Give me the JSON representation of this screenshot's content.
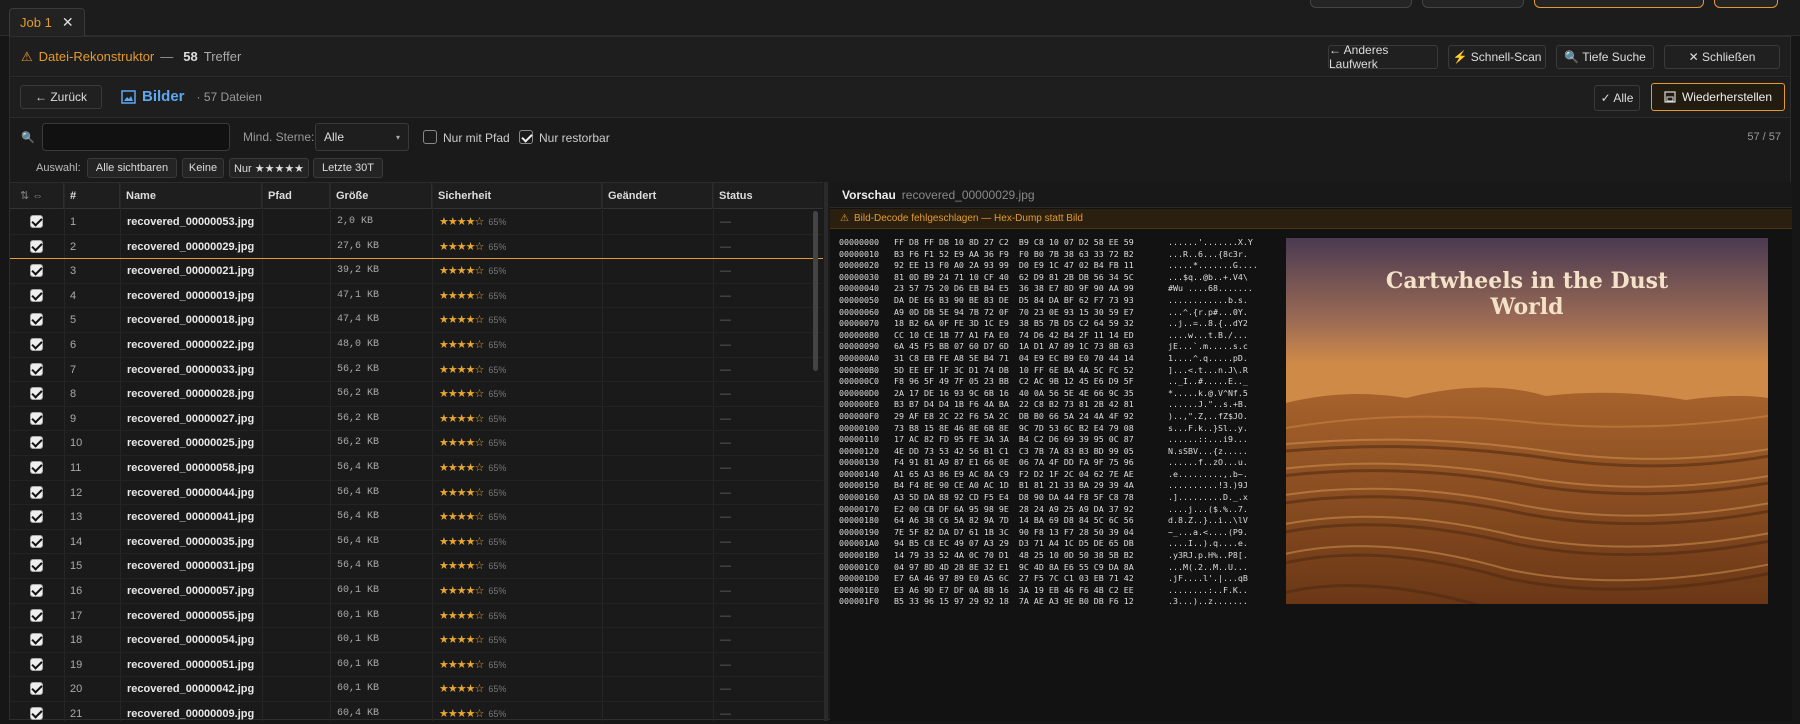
{
  "tab": {
    "label": "Job 1",
    "close": "✕"
  },
  "header": {
    "icon": "⚠",
    "title": "Datei-Rekonstruktor",
    "sep": "—",
    "count": "58",
    "count_label": "Treffer",
    "buttons": {
      "other_drive": "← Anderes Laufwerk",
      "quick_scan": "⚡ Schnell-Scan",
      "deep_search": "🔍 Tiefe Suche",
      "close": "✕ Schließen"
    }
  },
  "nav": {
    "back": "← Zurück",
    "section_icon": "image-icon",
    "section": "Bilder",
    "file_count": "· 57 Dateien",
    "select_all": "✓ Alle",
    "restore": "Wiederherstellen"
  },
  "filter": {
    "search_value": "",
    "min_stars_label": "Mind. Sterne:",
    "min_stars_value": "Alle",
    "only_path": "Nur mit Pfad",
    "only_path_checked": false,
    "only_restorable": "Nur restorbar",
    "only_restorable_checked": true,
    "pager": "57 / 57"
  },
  "selection": {
    "label": "Auswahl:",
    "all_visible": "Alle sichtbaren",
    "none": "Keine",
    "five_star": "Nur ★★★★★",
    "last30": "Letzte 30T"
  },
  "table": {
    "columns": {
      "num": "#",
      "name": "Name",
      "path": "Pfad",
      "size": "Größe",
      "confidence": "Sicherheit",
      "modified": "Geändert",
      "status": "Status"
    },
    "header_icons": [
      "sort-icon",
      "expand-icon"
    ],
    "rows": [
      {
        "num": "1",
        "name": "recovered_00000053.jpg",
        "size": "2,0 KB",
        "stars": "★★★★☆",
        "pct": "65%",
        "status": "—"
      },
      {
        "num": "2",
        "name": "recovered_00000029.jpg",
        "size": "27,6 KB",
        "stars": "★★★★☆",
        "pct": "65%",
        "status": "—"
      },
      {
        "num": "3",
        "name": "recovered_00000021.jpg",
        "size": "39,2 KB",
        "stars": "★★★★☆",
        "pct": "65%",
        "status": "—"
      },
      {
        "num": "4",
        "name": "recovered_00000019.jpg",
        "size": "47,1 KB",
        "stars": "★★★★☆",
        "pct": "65%",
        "status": "—"
      },
      {
        "num": "5",
        "name": "recovered_00000018.jpg",
        "size": "47,4 KB",
        "stars": "★★★★☆",
        "pct": "65%",
        "status": "—"
      },
      {
        "num": "6",
        "name": "recovered_00000022.jpg",
        "size": "48,0 KB",
        "stars": "★★★★☆",
        "pct": "65%",
        "status": "—"
      },
      {
        "num": "7",
        "name": "recovered_00000033.jpg",
        "size": "56,2 KB",
        "stars": "★★★★☆",
        "pct": "65%",
        "status": "—"
      },
      {
        "num": "8",
        "name": "recovered_00000028.jpg",
        "size": "56,2 KB",
        "stars": "★★★★☆",
        "pct": "65%",
        "status": "—"
      },
      {
        "num": "9",
        "name": "recovered_00000027.jpg",
        "size": "56,2 KB",
        "stars": "★★★★☆",
        "pct": "65%",
        "status": "—"
      },
      {
        "num": "10",
        "name": "recovered_00000025.jpg",
        "size": "56,2 KB",
        "stars": "★★★★☆",
        "pct": "65%",
        "status": "—"
      },
      {
        "num": "11",
        "name": "recovered_00000058.jpg",
        "size": "56,4 KB",
        "stars": "★★★★☆",
        "pct": "65%",
        "status": "—"
      },
      {
        "num": "12",
        "name": "recovered_00000044.jpg",
        "size": "56,4 KB",
        "stars": "★★★★☆",
        "pct": "65%",
        "status": "—"
      },
      {
        "num": "13",
        "name": "recovered_00000041.jpg",
        "size": "56,4 KB",
        "stars": "★★★★☆",
        "pct": "65%",
        "status": "—"
      },
      {
        "num": "14",
        "name": "recovered_00000035.jpg",
        "size": "56,4 KB",
        "stars": "★★★★☆",
        "pct": "65%",
        "status": "—"
      },
      {
        "num": "15",
        "name": "recovered_00000031.jpg",
        "size": "56,4 KB",
        "stars": "★★★★☆",
        "pct": "65%",
        "status": "—"
      },
      {
        "num": "16",
        "name": "recovered_00000057.jpg",
        "size": "60,1 KB",
        "stars": "★★★★☆",
        "pct": "65%",
        "status": "—"
      },
      {
        "num": "17",
        "name": "recovered_00000055.jpg",
        "size": "60,1 KB",
        "stars": "★★★★☆",
        "pct": "65%",
        "status": "—"
      },
      {
        "num": "18",
        "name": "recovered_00000054.jpg",
        "size": "60,1 KB",
        "stars": "★★★★☆",
        "pct": "65%",
        "status": "—"
      },
      {
        "num": "19",
        "name": "recovered_00000051.jpg",
        "size": "60,1 KB",
        "stars": "★★★★☆",
        "pct": "65%",
        "status": "—"
      },
      {
        "num": "20",
        "name": "recovered_00000042.jpg",
        "size": "60,1 KB",
        "stars": "★★★★☆",
        "pct": "65%",
        "status": "—"
      },
      {
        "num": "21",
        "name": "recovered_00000009.jpg",
        "size": "60,4 KB",
        "stars": "★★★★☆",
        "pct": "65%",
        "status": "—"
      }
    ]
  },
  "preview": {
    "label": "Vorschau",
    "filename": "recovered_00000029.jpg",
    "warning": "Bild-Decode fehlgeschlagen — Hex-Dump statt Bild",
    "image_title_line1": "Cartwheels in the Dust",
    "image_title_line2": "World",
    "hex_lines": [
      [
        "00000000",
        "FF D8 FF DB 10 8D 27 C2  B9 C8 10 07 D2 58 EE 59",
        "......'.......X.Y"
      ],
      [
        "00000010",
        "B3 F6 F1 52 E9 AA 36 F9  F0 B0 7B 38 63 33 72 B2",
        "...R..6...{8c3r."
      ],
      [
        "00000020",
        "92 EE 13 F0 A0 2A 93 99  D0 E9 1C 47 02 B4 FB 11",
        ".....*.......G...."
      ],
      [
        "00000030",
        "81 0D B9 24 71 10 CF 40  62 D9 81 2B DB 56 34 5C",
        "...$q..@b..+.V4\\"
      ],
      [
        "00000040",
        "23 57 75 20 D6 EB B4 E5  36 38 E7 8D 9F 90 AA 99",
        "#Wu ....68......."
      ],
      [
        "00000050",
        "DA DE E6 B3 90 BE 83 DE  D5 84 DA BF 62 F7 73 93",
        "............b.s."
      ],
      [
        "00000060",
        "A9 0D DB 5E 94 7B 72 0F  70 23 0E 93 15 30 59 E7",
        "...^.{r.p#...0Y."
      ],
      [
        "00000070",
        "18 B2 6A 0F FE 3D 1C E9  38 B5 7B D5 C2 64 59 32",
        "..j..=..8.{..dY2"
      ],
      [
        "00000080",
        "CC 10 CE 1B 77 A1 FA E0  74 D6 42 B4 2F 11 14 ED",
        "....w...t.B./..."
      ],
      [
        "00000090",
        "6A 45 F5 BB 07 60 D7 6D  1A D1 A7 89 1C 73 8B 63",
        "jE...`.m.....s.c"
      ],
      [
        "000000A0",
        "31 C8 EB FE A8 5E B4 71  04 E9 EC B9 E0 70 44 14",
        "1....^.q.....pD."
      ],
      [
        "000000B0",
        "5D EE EF 1F 3C D1 74 DB  10 FF 6E BA 4A 5C FC 52",
        "]...<.t...n.J\\.R"
      ],
      [
        "000000C0",
        "F8 96 5F 49 7F 05 23 BB  C2 AC 9B 12 45 E6 D9 5F",
        ".._I..#.....E.._"
      ],
      [
        "000000D0",
        "2A 17 DE 16 93 9C 6B 16  40 0A 56 5E 4E 66 9C 35",
        "*.....k.@.V^Nf.5"
      ],
      [
        "000000E0",
        "B3 B7 D4 D4 1B F6 4A BA  22 C8 B2 73 81 2B 42 81",
        "......J.\"..s.+B."
      ],
      [
        "000000F0",
        "29 AF E8 2C 22 F6 5A 2C  DB B0 66 5A 24 4A 4F 92",
        ")..,\".Z,..fZ$JO."
      ],
      [
        "00000100",
        "73 B8 15 8E 46 8E 6B 8E  9C 7D 53 6C B2 E4 79 08",
        "s...F.k..}Sl..y."
      ],
      [
        "00000110",
        "17 AC 82 FD 95 FE 3A 3A  B4 C2 D6 69 39 95 0C 87",
        "......::...i9..."
      ],
      [
        "00000120",
        "4E DD 73 53 42 56 B1 C1  C3 7B 7A 83 B3 BD 99 05",
        "N.sSBV...{z....."
      ],
      [
        "00000130",
        "F4 91 81 A9 87 E1 66 0E  06 7A 4F DD FA 9F 75 96",
        "......f..zO...u."
      ],
      [
        "00000140",
        "A1 65 A3 86 E9 AC 8A C9  F2 D2 1F 2C 04 62 7E AE",
        ".e.........,.b~."
      ],
      [
        "00000150",
        "B4 F4 8E 90 CE A0 AC 1D  B1 81 21 33 BA 29 39 4A",
        "..........!3.)9J"
      ],
      [
        "00000160",
        "A3 5D DA 88 92 CD F5 E4  D8 90 DA 44 F8 5F C8 78",
        ".].........D._.x"
      ],
      [
        "00000170",
        "E2 00 CB DF 6A 95 98 9E  28 24 A9 25 A9 DA 37 92",
        "....j...($.%..7."
      ],
      [
        "00000180",
        "64 A6 38 C6 5A 82 9A 7D  14 BA 69 D8 84 5C 6C 56",
        "d.8.Z..}..i..\\lV"
      ],
      [
        "00000190",
        "7E 5F 82 DA D7 61 1B 3C  90 F8 13 F7 28 50 39 04",
        "~_...a.<....(P9."
      ],
      [
        "000001A0",
        "94 B5 C8 EC 49 07 A3 29  D3 71 A4 1C D5 DE 65 DB",
        "....I..).q....e."
      ],
      [
        "000001B0",
        "14 79 33 52 4A 0C 70 D1  48 25 10 0D 50 38 5B B2",
        ".y3RJ.p.H%..P8[."
      ],
      [
        "000001C0",
        "04 97 8D 4D 28 8E 32 E1  9C 4D 8A E6 55 C9 DA 8A",
        "...M(.2..M..U..."
      ],
      [
        "000001D0",
        "E7 6A 46 97 89 E0 A5 6C  27 F5 7C C1 03 EB 71 42",
        ".jF....l'.|...qB"
      ],
      [
        "000001E0",
        "E3 A6 9D E7 DF 0A 8B 16  3A 19 EB 46 F6 4B C2 EE",
        "........:..F.K.."
      ],
      [
        "000001F0",
        "B5 33 96 15 97 29 92 18  7A AE A3 9E B0 DB F6 12",
        ".3...)..z......."
      ]
    ]
  }
}
